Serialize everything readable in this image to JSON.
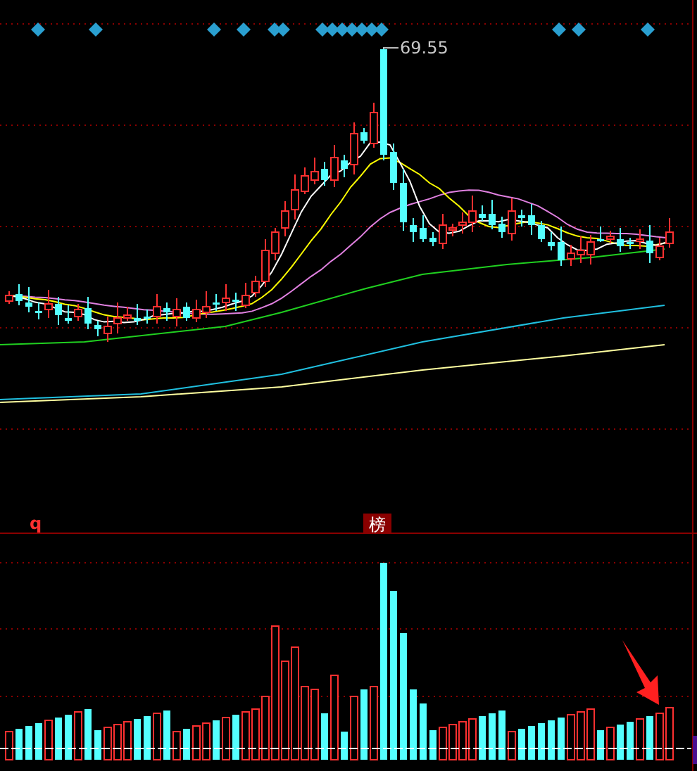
{
  "price_panel": {
    "high_label": "69.55"
  },
  "volume_panel": {
    "label": "q",
    "title_badge": "榜"
  }
}
